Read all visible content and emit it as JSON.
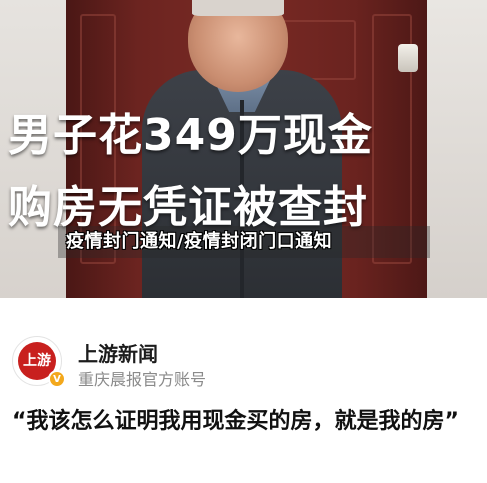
{
  "hero": {
    "headline_line1": "男子花349万现金",
    "headline_line2": "购房无凭证被查封",
    "caption": "疫情封门通知/疫情封闭门口通知"
  },
  "account": {
    "avatar_text": "上游",
    "verified_glyph": "V",
    "name": "上游新闻",
    "description": "重庆晨报官方账号"
  },
  "article": {
    "quote": "“我该怎么证明我用现金买的房，就是我的房”"
  },
  "colors": {
    "brand_red": "#c8201e",
    "verified_gold": "#f3a81c",
    "door_red": "#6c2420"
  }
}
